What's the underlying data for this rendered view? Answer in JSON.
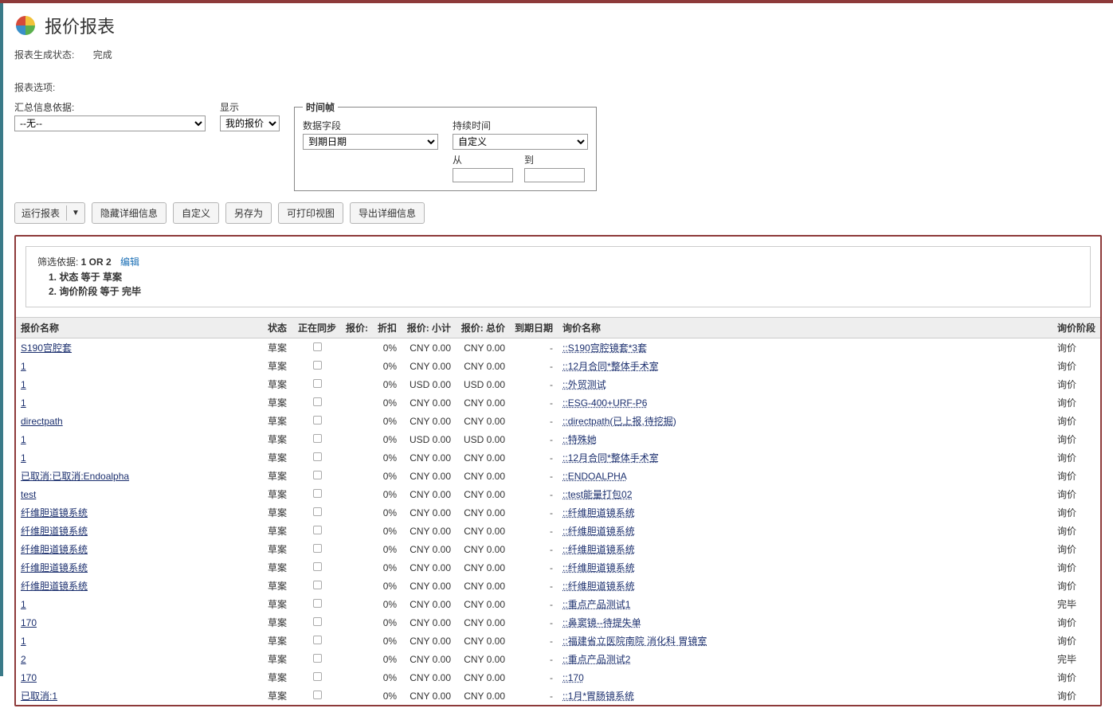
{
  "header": {
    "title": "报价报表"
  },
  "status": {
    "label": "报表生成状态:",
    "value": "完成"
  },
  "options_label": "报表选项:",
  "summary": {
    "label": "汇总信息依据:",
    "selected": "--无--"
  },
  "display": {
    "label": "显示",
    "selected": "我的报价"
  },
  "timeframe": {
    "legend": "时间帧",
    "data_field": {
      "label": "数据字段",
      "selected": "到期日期"
    },
    "duration": {
      "label": "持续时间",
      "selected": "自定义"
    },
    "from": {
      "label": "从"
    },
    "to": {
      "label": "到"
    }
  },
  "toolbar": {
    "run": "运行报表",
    "hide_details": "隐藏详细信息",
    "customize": "自定义",
    "save_as": "另存为",
    "printable": "可打印视图",
    "export": "导出详细信息"
  },
  "filter": {
    "label": "筛选依据: ",
    "expr": "1 OR 2",
    "edit": "编辑",
    "cond1": "1. 状态 等于 草案",
    "cond2": "2. 询价阶段 等于 完毕"
  },
  "columns": {
    "quote_name": "报价名称",
    "status": "状态",
    "syncing": "正在同步",
    "price": "报价:",
    "discount": "折扣",
    "subtotal": "报价: 小计",
    "total": "报价: 总价",
    "due_date": "到期日期",
    "inquiry_name": "询价名称",
    "inquiry_stage": "询价阶段"
  },
  "rows": [
    {
      "name": "S190宫腔套",
      "status": "草案",
      "discount": "0%",
      "subtotal": "CNY 0.00",
      "total": "CNY 0.00",
      "due": "-",
      "iname": "::S190宫腔镜套*3套",
      "stage": "询价"
    },
    {
      "name": "1",
      "status": "草案",
      "discount": "0%",
      "subtotal": "CNY 0.00",
      "total": "CNY 0.00",
      "due": "-",
      "iname": "::12月合同*整体手术室",
      "stage": "询价"
    },
    {
      "name": "1",
      "status": "草案",
      "discount": "0%",
      "subtotal": "USD 0.00",
      "total": "USD 0.00",
      "due": "-",
      "iname": "::外贸测试",
      "stage": "询价"
    },
    {
      "name": "1",
      "status": "草案",
      "discount": "0%",
      "subtotal": "CNY 0.00",
      "total": "CNY 0.00",
      "due": "-",
      "iname": "::ESG-400+URF-P6",
      "stage": "询价"
    },
    {
      "name": "directpath",
      "status": "草案",
      "discount": "0%",
      "subtotal": "CNY 0.00",
      "total": "CNY 0.00",
      "due": "-",
      "iname": "::directpath(已上报,待挖掘)",
      "stage": "询价"
    },
    {
      "name": "1",
      "status": "草案",
      "discount": "0%",
      "subtotal": "USD 0.00",
      "total": "USD 0.00",
      "due": "-",
      "iname": "::特殊她",
      "stage": "询价"
    },
    {
      "name": "1",
      "status": "草案",
      "discount": "0%",
      "subtotal": "CNY 0.00",
      "total": "CNY 0.00",
      "due": "-",
      "iname": "::12月合同*整体手术室",
      "stage": "询价"
    },
    {
      "name": "已取消:已取消:Endoalpha",
      "status": "草案",
      "discount": "0%",
      "subtotal": "CNY 0.00",
      "total": "CNY 0.00",
      "due": "-",
      "iname": "::ENDOALPHA",
      "stage": "询价"
    },
    {
      "name": "test",
      "status": "草案",
      "discount": "0%",
      "subtotal": "CNY 0.00",
      "total": "CNY 0.00",
      "due": "-",
      "iname": "::test能量打包02",
      "stage": "询价"
    },
    {
      "name": "纤维胆道镜系统",
      "status": "草案",
      "discount": "0%",
      "subtotal": "CNY 0.00",
      "total": "CNY 0.00",
      "due": "-",
      "iname": "::纤维胆道镜系统",
      "stage": "询价"
    },
    {
      "name": "纤维胆道镜系统",
      "status": "草案",
      "discount": "0%",
      "subtotal": "CNY 0.00",
      "total": "CNY 0.00",
      "due": "-",
      "iname": "::纤维胆道镜系统",
      "stage": "询价"
    },
    {
      "name": "纤维胆道镜系统",
      "status": "草案",
      "discount": "0%",
      "subtotal": "CNY 0.00",
      "total": "CNY 0.00",
      "due": "-",
      "iname": "::纤维胆道镜系统",
      "stage": "询价"
    },
    {
      "name": "纤维胆道镜系统",
      "status": "草案",
      "discount": "0%",
      "subtotal": "CNY 0.00",
      "total": "CNY 0.00",
      "due": "-",
      "iname": "::纤维胆道镜系统",
      "stage": "询价"
    },
    {
      "name": "纤维胆道镜系统",
      "status": "草案",
      "discount": "0%",
      "subtotal": "CNY 0.00",
      "total": "CNY 0.00",
      "due": "-",
      "iname": "::纤维胆道镜系统",
      "stage": "询价"
    },
    {
      "name": "1",
      "status": "草案",
      "discount": "0%",
      "subtotal": "CNY 0.00",
      "total": "CNY 0.00",
      "due": "-",
      "iname": "::重点产品测试1",
      "stage": "完毕"
    },
    {
      "name": "170",
      "status": "草案",
      "discount": "0%",
      "subtotal": "CNY 0.00",
      "total": "CNY 0.00",
      "due": "-",
      "iname": "::鼻窦镜--待提失单",
      "stage": "询价"
    },
    {
      "name": "1",
      "status": "草案",
      "discount": "0%",
      "subtotal": "CNY 0.00",
      "total": "CNY 0.00",
      "due": "-",
      "iname": "::福建省立医院南院 消化科 胃镜室",
      "stage": "询价"
    },
    {
      "name": "2",
      "status": "草案",
      "discount": "0%",
      "subtotal": "CNY 0.00",
      "total": "CNY 0.00",
      "due": "-",
      "iname": "::重点产品测试2",
      "stage": "完毕"
    },
    {
      "name": "170",
      "status": "草案",
      "discount": "0%",
      "subtotal": "CNY 0.00",
      "total": "CNY 0.00",
      "due": "-",
      "iname": "::170",
      "stage": "询价"
    },
    {
      "name": "已取消:1",
      "status": "草案",
      "discount": "0%",
      "subtotal": "CNY 0.00",
      "total": "CNY 0.00",
      "due": "-",
      "iname": "::1月*胃肠镜系统",
      "stage": "询价"
    }
  ]
}
